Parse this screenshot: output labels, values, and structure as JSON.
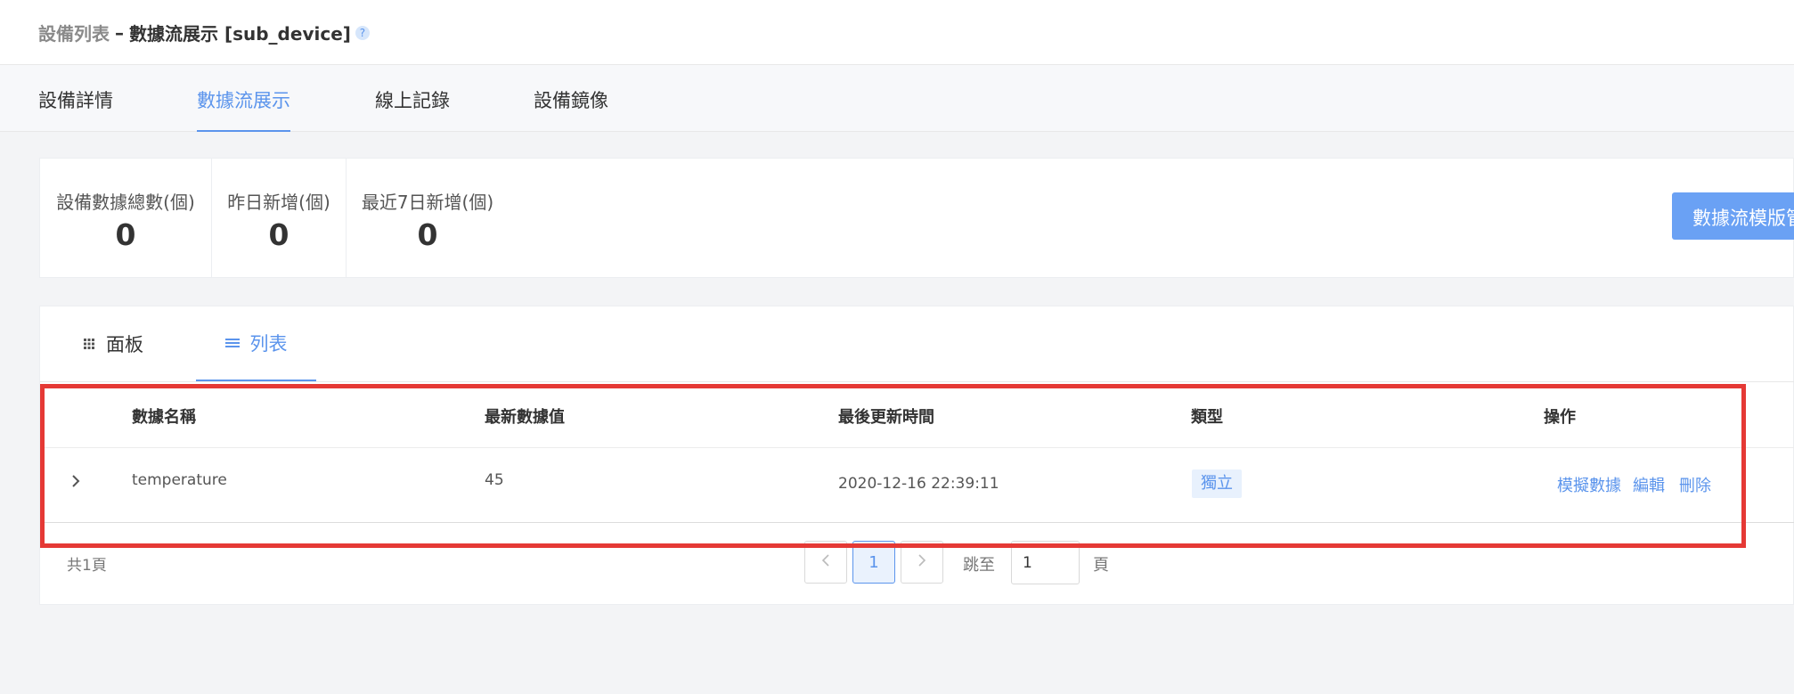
{
  "breadcrumb": {
    "parent": "設備列表",
    "separator": "–",
    "current": "數據流展示 [sub_device]",
    "help": "?"
  },
  "tabs": [
    {
      "label": "設備詳情"
    },
    {
      "label": "數據流展示"
    },
    {
      "label": "線上記錄"
    },
    {
      "label": "設備鏡像"
    }
  ],
  "stats": [
    {
      "label": "設備數據總數(個)",
      "value": "0"
    },
    {
      "label": "昨日新增(個)",
      "value": "0"
    },
    {
      "label": "最近7日新增(個)",
      "value": "0"
    }
  ],
  "template_button": "數據流模版管",
  "view_tabs": [
    {
      "label": "面板",
      "icon": "grid-icon"
    },
    {
      "label": "列表",
      "icon": "list-icon"
    }
  ],
  "table": {
    "headers": [
      "數據名稱",
      "最新數據值",
      "最後更新時間",
      "類型",
      "操作"
    ],
    "rows": [
      {
        "name": "temperature",
        "value": "45",
        "updated": "2020-12-16 22:39:11",
        "type": "獨立",
        "actions": [
          "模擬數據",
          "編輯",
          "刪除"
        ]
      }
    ]
  },
  "pagination": {
    "total": "共1頁",
    "current": "1",
    "jump_label": "跳至",
    "jump_value": "1",
    "page_suffix": "頁"
  },
  "colors": {
    "accent": "#5b94ec",
    "highlight": "#e53935"
  }
}
